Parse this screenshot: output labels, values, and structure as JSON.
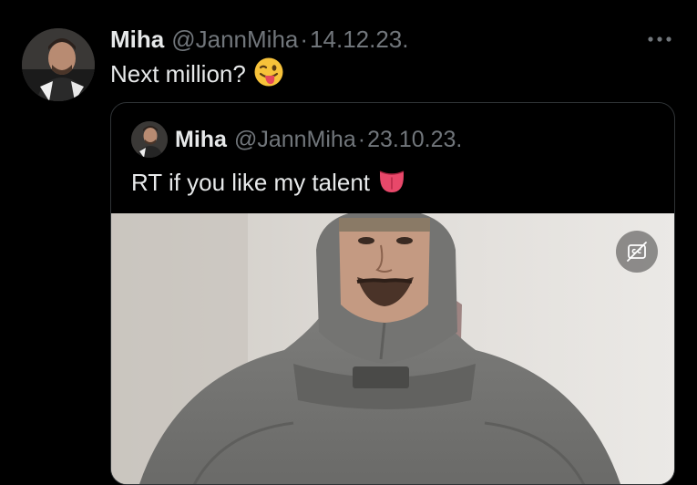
{
  "tweet": {
    "author_name": "Miha",
    "author_handle": "@JannMiha",
    "separator": "·",
    "date": "14.12.23.",
    "text": "Next million?",
    "emoji_icon": "winking-face-with-tongue-icon",
    "more_icon": "more-options-icon"
  },
  "quoted_tweet": {
    "author_name": "Miha",
    "author_handle": "@JannMiha",
    "separator": "·",
    "date": "23.10.23.",
    "text": "RT if you like my talent",
    "emoji_icon": "tongue-icon",
    "media": {
      "type": "video",
      "captions_icon": "closed-captions-off-icon"
    }
  },
  "colors": {
    "background": "#000000",
    "text_primary": "#e7e9ea",
    "text_secondary": "#71767b",
    "border": "#2f3336"
  }
}
